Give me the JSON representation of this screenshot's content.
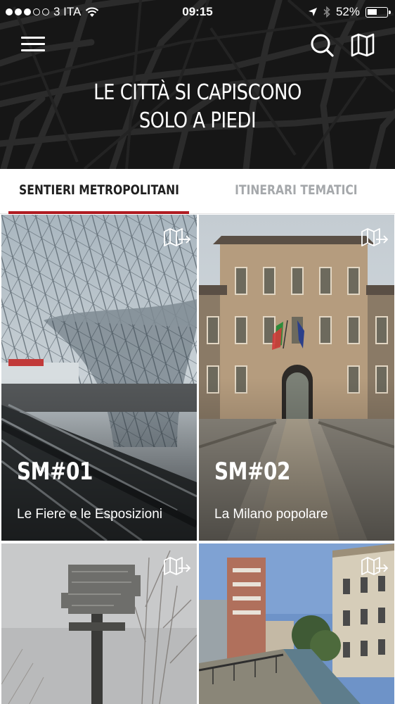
{
  "status_bar": {
    "carrier": "3 ITA",
    "time": "09:15",
    "battery_percent": "52%",
    "battery_level": 0.52,
    "signal_dots_filled": 3,
    "signal_dots_total": 5
  },
  "header": {
    "menu_icon": "hamburger-menu-icon",
    "search_icon": "search-icon",
    "map_icon": "folded-map-icon",
    "tagline_line1": "LE CITTÀ SI CAPISCONO",
    "tagline_line2": "SOLO A PIEDI"
  },
  "tabs": [
    {
      "label": "SENTIERI METROPOLITANI",
      "active": true
    },
    {
      "label": "ITINERARI TEMATICI",
      "active": false
    }
  ],
  "colors": {
    "accent": "#b01c22",
    "header_bg": "#141414",
    "tab_active_text": "#1f1f1f",
    "tab_inactive_text": "#a5a8ab"
  },
  "cards": [
    {
      "code": "SM#01",
      "title": "Le Fiere e le Esposizioni",
      "action_icon": "map-export-icon"
    },
    {
      "code": "SM#02",
      "title": "La Milano popolare",
      "action_icon": "map-export-icon"
    },
    {
      "code": "",
      "title": "",
      "action_icon": "map-export-icon"
    },
    {
      "code": "",
      "title": "",
      "action_icon": "map-export-icon"
    }
  ]
}
